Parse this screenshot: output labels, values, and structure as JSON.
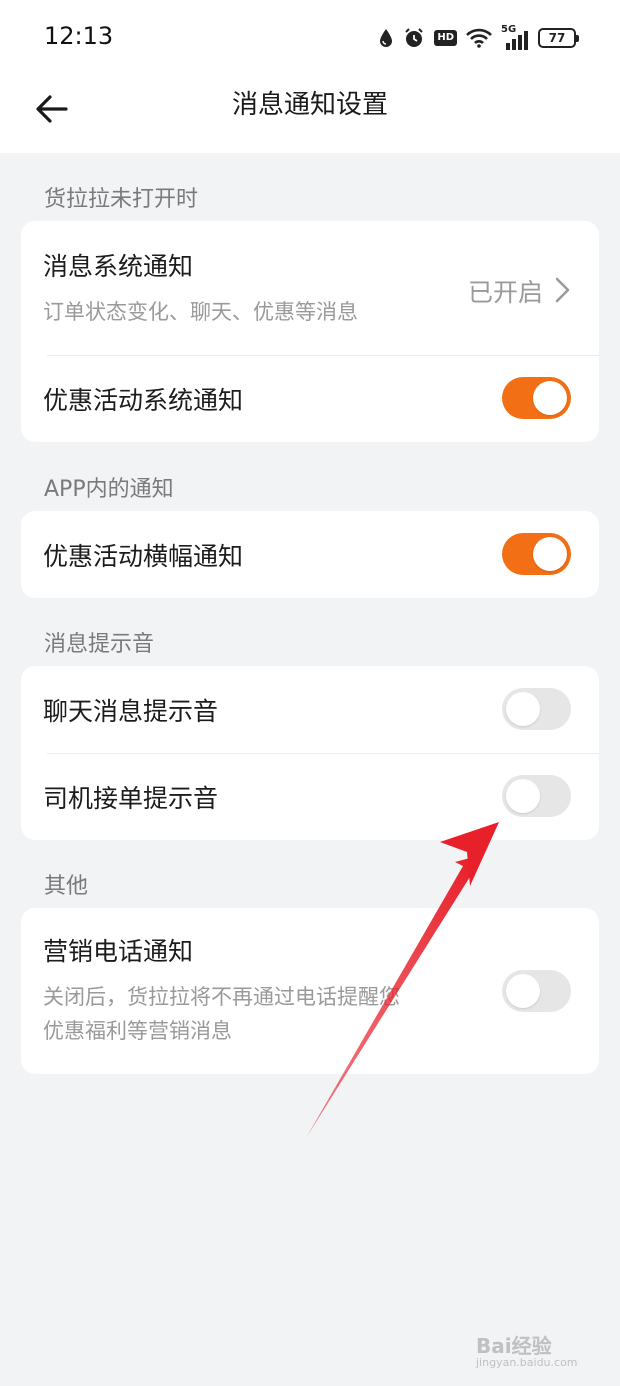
{
  "status_bar": {
    "time": "12:13",
    "network": "5G",
    "hd": "HD",
    "battery": "77"
  },
  "header": {
    "title": "消息通知设置",
    "back_icon": "arrow-left-icon"
  },
  "sections": [
    {
      "title": "货拉拉未打开时",
      "items": [
        {
          "label": "消息系统通知",
          "sublabel": "订单状态变化、聊天、优惠等消息",
          "status": "已开启",
          "type": "link"
        },
        {
          "label": "优惠活动系统通知",
          "type": "toggle",
          "on": true
        }
      ]
    },
    {
      "title": "APP内的通知",
      "items": [
        {
          "label": "优惠活动横幅通知",
          "type": "toggle",
          "on": true
        }
      ]
    },
    {
      "title": "消息提示音",
      "items": [
        {
          "label": "聊天消息提示音",
          "type": "toggle",
          "on": false
        },
        {
          "label": "司机接单提示音",
          "type": "toggle",
          "on": false
        }
      ]
    },
    {
      "title": "其他",
      "items": [
        {
          "label": "营销电话通知",
          "sublabel": "关闭后，货拉拉将不再通过电话提醒您优惠福利等营销消息",
          "sublabel_line1": "关闭后，货拉拉将不再通过电话提醒您",
          "sublabel_line2": "优惠福利等营销消息",
          "type": "toggle",
          "on": false
        }
      ]
    }
  ],
  "colors": {
    "accent": "#f26f15",
    "background": "#f2f3f5",
    "annotation_arrow": "#e8202a"
  },
  "watermark": {
    "text": "Bai经验",
    "sub": "jingyan.baidu.com"
  }
}
